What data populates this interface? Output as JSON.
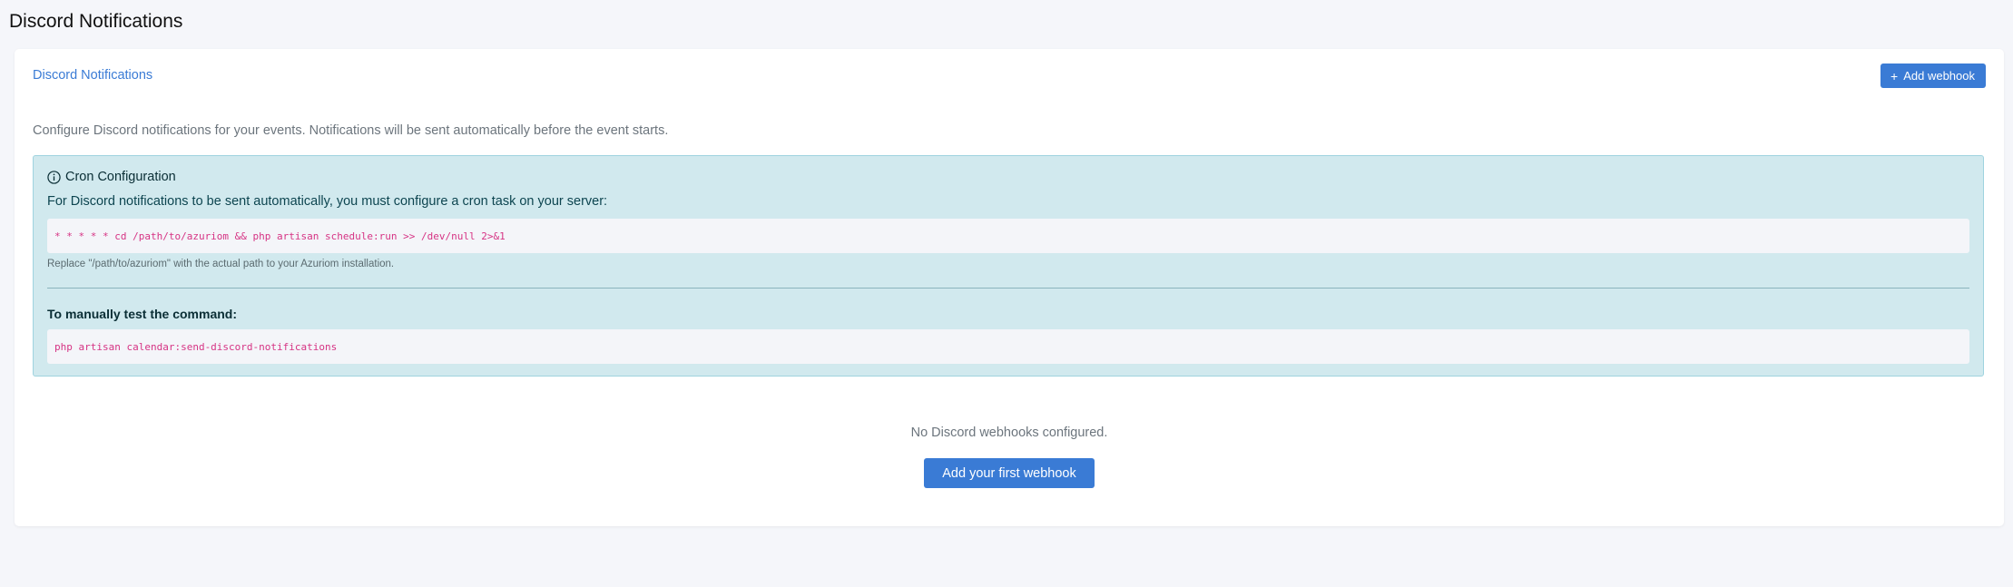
{
  "page": {
    "title": "Discord Notifications"
  },
  "card": {
    "header_title": "Discord Notifications",
    "add_button_label": "Add webhook",
    "add_button_icon": "plus-icon",
    "description": "Configure Discord notifications for your events. Notifications will be sent automatically before the event starts."
  },
  "alert": {
    "icon": "info-circle-icon",
    "heading": "Cron Configuration",
    "text": "For Discord notifications to be sent automatically, you must configure a cron task on your server:",
    "cron_command": "* * * * * cd /path/to/azuriom && php artisan schedule:run >> /dev/null 2>&1",
    "note": "Replace \"/path/to/azuriom\" with the actual path to your Azuriom installation.",
    "test_heading": "To manually test the command:",
    "test_command": "php artisan calendar:send-discord-notifications"
  },
  "empty_state": {
    "text": "No Discord webhooks configured.",
    "button_label": "Add your first webhook"
  },
  "colors": {
    "accent": "#3a7bd5",
    "alert_bg": "#d1e9ee",
    "code_text": "#d63384",
    "page_bg": "#f5f6fa"
  }
}
